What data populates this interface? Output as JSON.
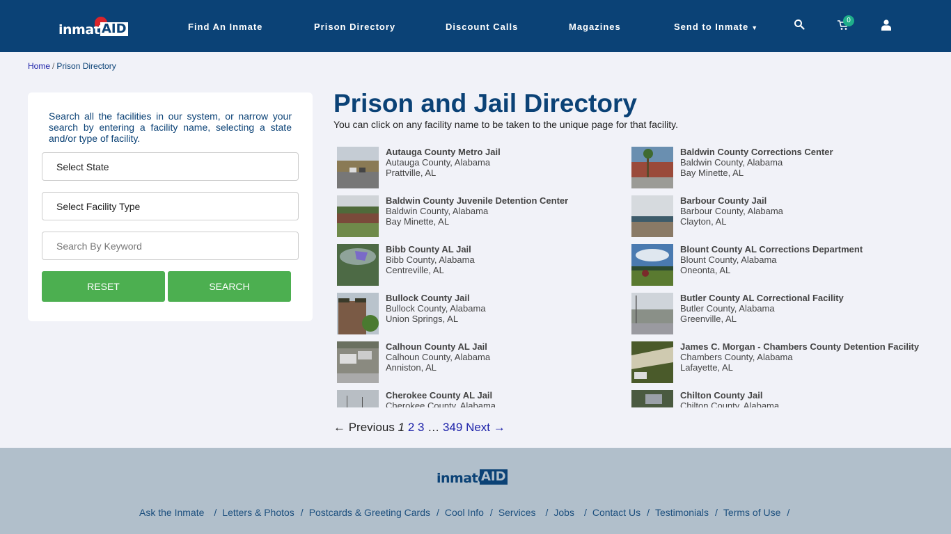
{
  "header": {
    "logo_text": "inmate",
    "logo_accent": "AID",
    "nav": [
      {
        "label": "Find An Inmate"
      },
      {
        "label": "Prison Directory"
      },
      {
        "label": "Discount Calls"
      },
      {
        "label": "Magazines"
      },
      {
        "label": "Send to Inmate",
        "has_dropdown": true,
        "caret": "▼"
      }
    ],
    "icons": {
      "search": "search-icon",
      "cart": "cart-icon",
      "user": "user-icon"
    },
    "cart_count": "0"
  },
  "breadcrumb": {
    "home": "Home",
    "separator": "/",
    "current": "Prison Directory"
  },
  "sidebar": {
    "intro": "Search all the facilities in our system, or narrow your search by entering a facility name, selecting a state and/or type of facility.",
    "state_select": "Select State",
    "type_select": "Select Facility Type",
    "keyword_placeholder": "Search By Keyword",
    "reset_label": "RESET",
    "search_label": "SEARCH"
  },
  "main": {
    "title": "Prison and Jail Directory",
    "subtitle": "You can click on any facility name to be taken to the unique page for that facility.",
    "facilities": [
      {
        "name": "Autauga County Metro Jail",
        "county": "Autauga County, Alabama",
        "city": "Prattville, AL"
      },
      {
        "name": "Baldwin County Corrections Center",
        "county": "Baldwin County, Alabama",
        "city": "Bay Minette, AL"
      },
      {
        "name": "Baldwin County Juvenile Detention Center",
        "county": "Baldwin County, Alabama",
        "city": "Bay Minette, AL"
      },
      {
        "name": "Barbour County Jail",
        "county": "Barbour County, Alabama",
        "city": "Clayton, AL"
      },
      {
        "name": "Bibb County AL Jail",
        "county": "Bibb County, Alabama",
        "city": "Centreville, AL"
      },
      {
        "name": "Blount County AL Corrections Department",
        "county": "Blount County, Alabama",
        "city": "Oneonta, AL"
      },
      {
        "name": "Bullock County Jail",
        "county": "Bullock County, Alabama",
        "city": "Union Springs, AL"
      },
      {
        "name": "Butler County AL Correctional Facility",
        "county": "Butler County, Alabama",
        "city": "Greenville, AL"
      },
      {
        "name": "Calhoun County AL Jail",
        "county": "Calhoun County, Alabama",
        "city": "Anniston, AL"
      },
      {
        "name": "James C. Morgan - Chambers County Detention Facility",
        "county": "Chambers County, Alabama",
        "city": "Lafayette, AL"
      },
      {
        "name": "Cherokee County AL Jail",
        "county": "Cherokee County, Alabama",
        "city": ""
      },
      {
        "name": "Chilton County Jail",
        "county": "Chilton County, Alabama",
        "city": ""
      }
    ],
    "pagination": {
      "previous": "← Previous",
      "current": "1",
      "pages": [
        "2",
        "3"
      ],
      "ellipsis": "…",
      "last": "349",
      "next": "Next →"
    }
  },
  "footer": {
    "logo_text": "inmate",
    "logo_accent": "AID",
    "links": [
      "Ask the Inmate",
      "Letters & Photos",
      "Postcards & Greeting Cards",
      "Cool Info",
      "Services",
      "Jobs",
      "Contact Us",
      "Testimonials",
      "Terms of Use"
    ],
    "separator": "/"
  },
  "colors": {
    "brand": "#0b4276",
    "button": "#4caf50",
    "badge": "#1fae8a",
    "footer_bg": "#b1bfcb"
  }
}
